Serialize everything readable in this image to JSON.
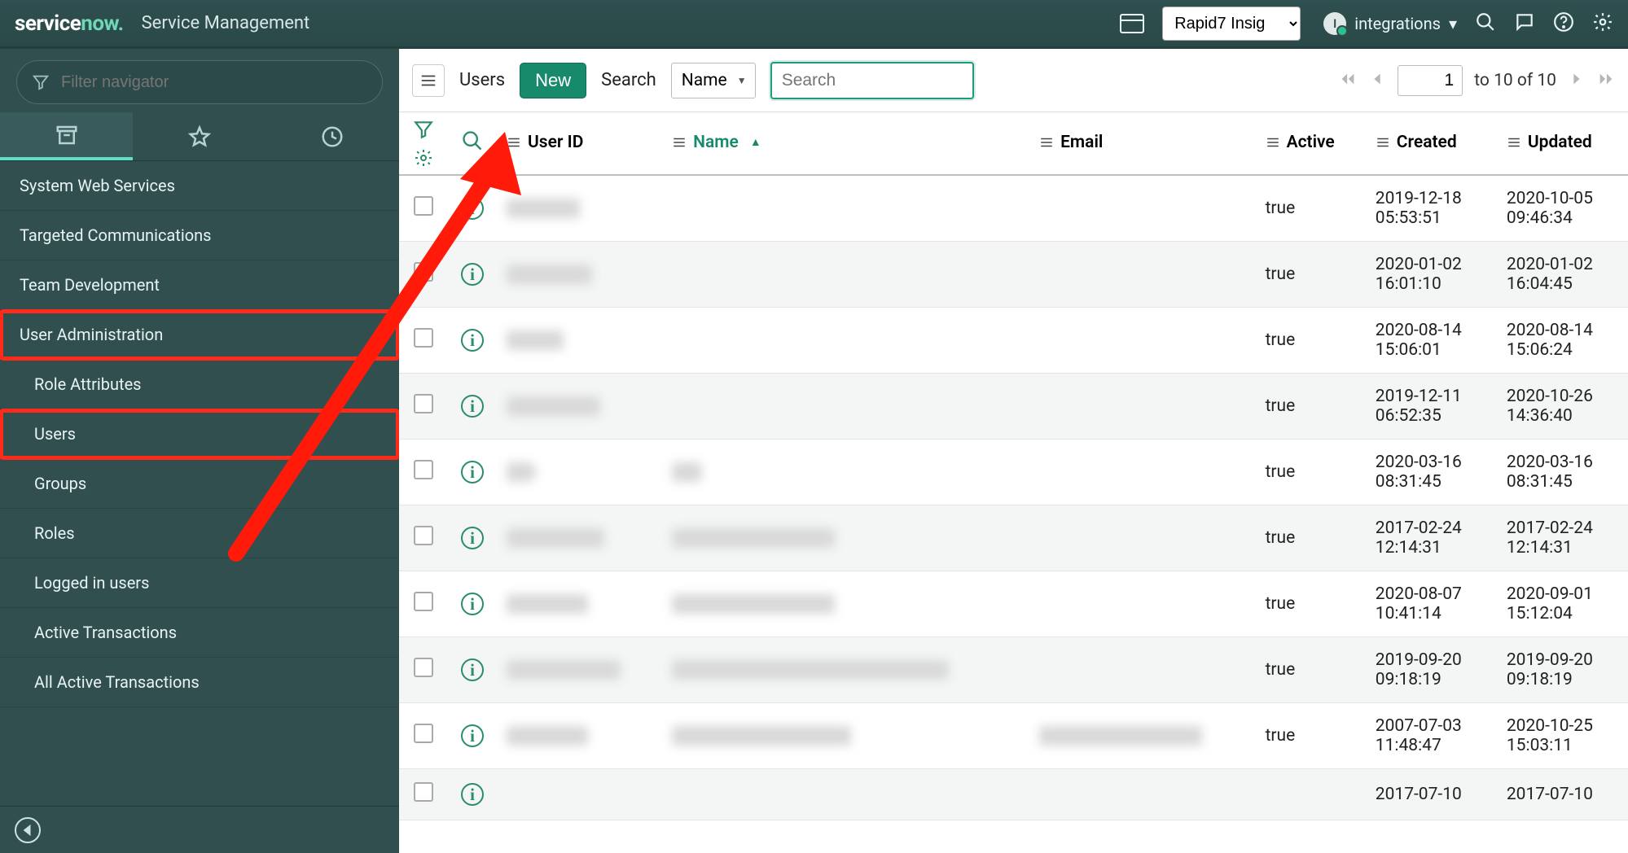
{
  "header": {
    "brand_prefix": "service",
    "brand_suffix": "now",
    "app_title": "Service Management",
    "selector_value": "Rapid7 Insig",
    "user_initial": "I",
    "user_label": "integrations"
  },
  "filter_placeholder": "Filter navigator",
  "nav_items": [
    {
      "label": "System Web Services",
      "sub": false,
      "hl": false
    },
    {
      "label": "Targeted Communications",
      "sub": false,
      "hl": false
    },
    {
      "label": "Team Development",
      "sub": false,
      "hl": false
    },
    {
      "label": "User Administration",
      "sub": false,
      "hl": true
    },
    {
      "label": "Role Attributes",
      "sub": true,
      "hl": false
    },
    {
      "label": "Users",
      "sub": true,
      "hl": true
    },
    {
      "label": "Groups",
      "sub": true,
      "hl": false
    },
    {
      "label": "Roles",
      "sub": true,
      "hl": false
    },
    {
      "label": "Logged in users",
      "sub": true,
      "hl": false
    },
    {
      "label": "Active Transactions",
      "sub": true,
      "hl": false
    },
    {
      "label": "All Active Transactions",
      "sub": true,
      "hl": false
    }
  ],
  "toolbar": {
    "list_label": "Users",
    "new_label": "New",
    "search_label": "Search",
    "search_field_value": "Name",
    "search_placeholder": "Search",
    "page_num": "1",
    "pager_text": "to 10 of 10"
  },
  "columns": {
    "user_id": "User ID",
    "name": "Name",
    "email": "Email",
    "active": "Active",
    "created": "Created",
    "updated": "Updated",
    "sort_marker": "▲"
  },
  "rows": [
    {
      "user_id_w": 90,
      "name_w": 0,
      "email_w": 0,
      "active": "true",
      "created": "2019-12-18 05:53:51",
      "updated": "2020-10-05 09:46:34"
    },
    {
      "user_id_w": 105,
      "name_w": 0,
      "email_w": 0,
      "active": "true",
      "created": "2020-01-02 16:01:10",
      "updated": "2020-01-02 16:04:45"
    },
    {
      "user_id_w": 70,
      "name_w": 0,
      "email_w": 0,
      "active": "true",
      "created": "2020-08-14 15:06:01",
      "updated": "2020-08-14 15:06:24"
    },
    {
      "user_id_w": 115,
      "name_w": 0,
      "email_w": 0,
      "active": "true",
      "created": "2019-12-11 06:52:35",
      "updated": "2020-10-26 14:36:40"
    },
    {
      "user_id_w": 32,
      "name_w": 36,
      "email_w": 0,
      "active": "true",
      "created": "2020-03-16 08:31:45",
      "updated": "2020-03-16 08:31:45"
    },
    {
      "user_id_w": 120,
      "name_w": 200,
      "email_w": 0,
      "active": "true",
      "created": "2017-02-24 12:14:31",
      "updated": "2017-02-24 12:14:31"
    },
    {
      "user_id_w": 100,
      "name_w": 200,
      "email_w": 0,
      "active": "true",
      "created": "2020-08-07 10:41:14",
      "updated": "2020-09-01 15:12:04"
    },
    {
      "user_id_w": 140,
      "name_w": 340,
      "email_w": 0,
      "active": "true",
      "created": "2019-09-20 09:18:19",
      "updated": "2019-09-20 09:18:19"
    },
    {
      "user_id_w": 100,
      "name_w": 220,
      "email_w": 200,
      "active": "true",
      "created": "2007-07-03 11:48:47",
      "updated": "2020-10-25 15:03:11"
    },
    {
      "user_id_w": 0,
      "name_w": 0,
      "email_w": 0,
      "active": "",
      "created": "2017-07-10",
      "updated": "2017-07-10"
    }
  ]
}
